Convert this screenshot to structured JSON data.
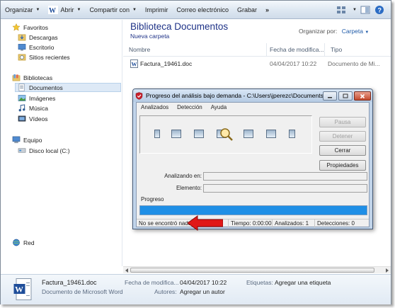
{
  "toolbar": {
    "organize": "Organizar",
    "open": "Abrir",
    "share": "Compartir con",
    "print": "Imprimir",
    "email": "Correo electrónico",
    "burn": "Grabar",
    "more": "»"
  },
  "nav": {
    "favorites": "Favoritos",
    "downloads": "Descargas",
    "desktop": "Escritorio",
    "recent": "Sitios recientes",
    "libraries": "Bibliotecas",
    "documents": "Documentos",
    "images": "Imágenes",
    "music": "Música",
    "videos": "Vídeos",
    "computer": "Equipo",
    "local_disk": "Disco local (C:)",
    "network": "Red"
  },
  "content": {
    "title": "Biblioteca Documentos",
    "subtitle": "Nueva carpeta",
    "arrange_label": "Organizar por:",
    "arrange_value": "Carpeta",
    "columns": [
      "Nombre",
      "Fecha de modifica...",
      "Tipo"
    ],
    "file": {
      "name": "Factura_19461.doc",
      "date": "04/04/2017 10:22",
      "type": "Documento de Mi..."
    }
  },
  "dialog": {
    "title": "Progreso del análisis bajo demanda - C:\\Users\\jperezc\\Documents...",
    "menu": [
      "Analizados",
      "Detección",
      "Ayuda"
    ],
    "buttons": {
      "pause": "Pausa",
      "stop": "Detener",
      "close": "Cerrar",
      "properties": "Propiedades"
    },
    "scanning_label": "Analizando en:",
    "element_label": "Elemento:",
    "progress_label": "Progreso",
    "progress_fraction": 1.0,
    "status": {
      "result": "No se encontró nada",
      "time": "Tiempo: 0:00:00",
      "scanned": "Analizados: 1",
      "detections": "Detecciones: 0"
    }
  },
  "details": {
    "filename": "Factura_19461.doc",
    "filetype": "Documento de Microsoft Word",
    "modified_label": "Fecha de modifica...",
    "modified_value": "04/04/2017 10:22",
    "tags_label": "Etiquetas:",
    "tags_value": "Agregar una etiqueta",
    "authors_label": "Autores:",
    "authors_value": "Agregar un autor"
  },
  "colors": {
    "accent_title": "#1e3287",
    "progress": "#1f8fe6",
    "arrow": "#e01818"
  }
}
